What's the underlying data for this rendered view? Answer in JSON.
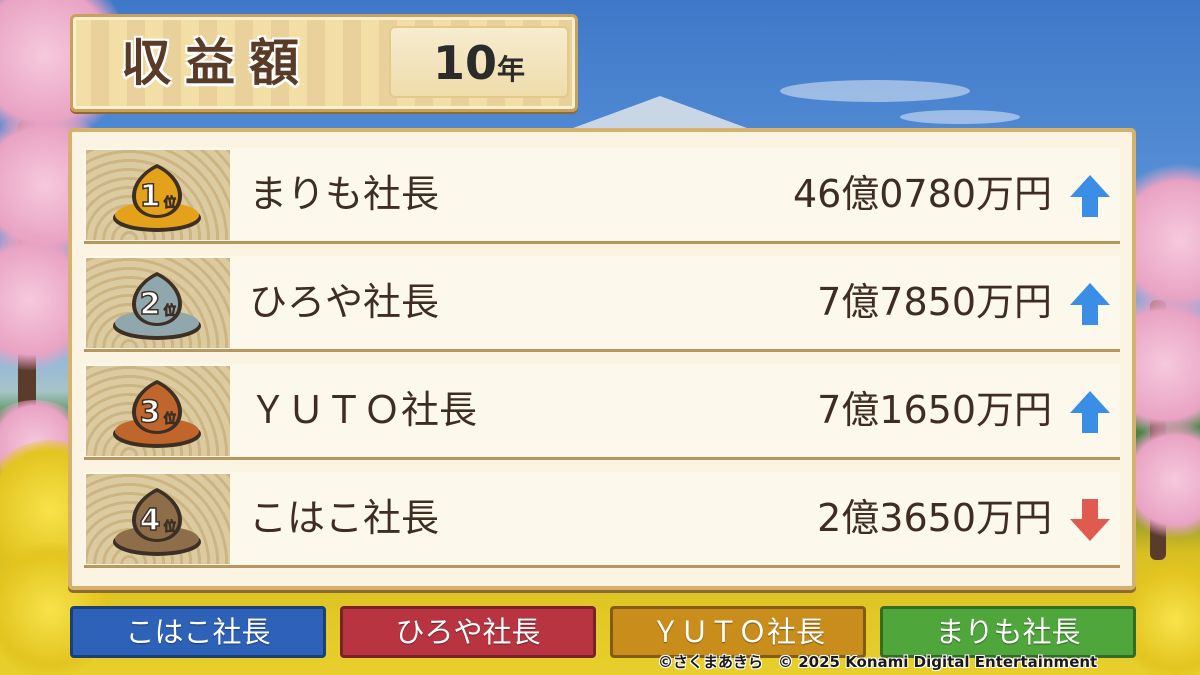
{
  "header": {
    "title": "収益額",
    "year_number": "10",
    "year_unit": "年"
  },
  "ranking": [
    {
      "rank": "1",
      "rank_suffix": "位",
      "name": "まりも社長",
      "amount": "46億0780万円",
      "trend": "up",
      "medal_color": "#e3a21a"
    },
    {
      "rank": "2",
      "rank_suffix": "位",
      "name": "ひろや社長",
      "amount": "7億7850万円",
      "trend": "up",
      "medal_color": "#8fa7ad"
    },
    {
      "rank": "3",
      "rank_suffix": "位",
      "name": "ＹＵＴＯ社長",
      "amount": "7億1650万円",
      "trend": "up",
      "medal_color": "#c0662d"
    },
    {
      "rank": "4",
      "rank_suffix": "位",
      "name": "こはこ社長",
      "amount": "2億3650万円",
      "trend": "down",
      "medal_color": "#8d6d4a"
    }
  ],
  "players": [
    {
      "label": "こはこ社長",
      "color": "#2d62b8"
    },
    {
      "label": "ひろや社長",
      "color": "#b83440"
    },
    {
      "label": "ＹＵＴＯ社長",
      "color": "#c98d1c"
    },
    {
      "label": "まりも社長",
      "color": "#4fa63a"
    }
  ],
  "copyright": "©さくまあきら　© 2025 Konami Digital Entertainment",
  "colors": {
    "trend_up": "#3b8ee6",
    "trend_down": "#e05a4f"
  }
}
